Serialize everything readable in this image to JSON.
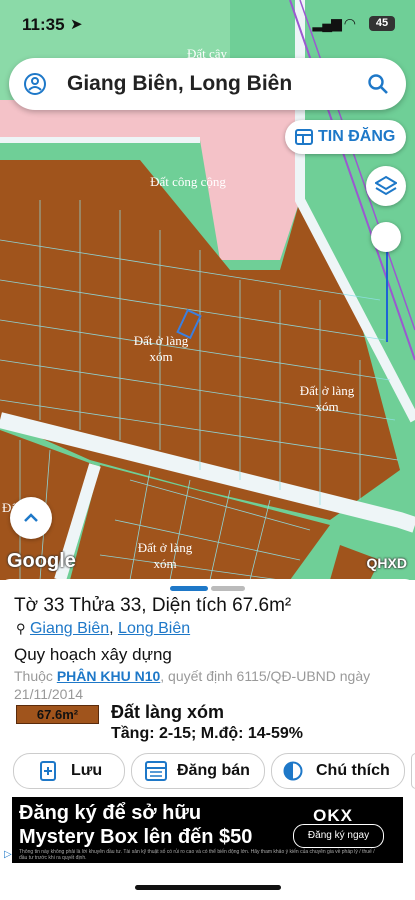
{
  "status_bar": {
    "time": "11:35",
    "battery": "45"
  },
  "search": {
    "query": "Giang Biên, Long Biên"
  },
  "map": {
    "tin_dang_label": "TIN ĐĂNG",
    "zone_labels": [
      "Đất cây",
      "Đất công cộng",
      "Đất ở làng xóm",
      "Đất ở làng xóm",
      "Đất ở làng xóm",
      "Đất",
      "Đất ở làng xóm"
    ],
    "google_label": "Google",
    "qhxd_label": "QHXD"
  },
  "parcel": {
    "title": "Tờ 33 Thửa 33, Diện tích 67.6m²",
    "ward": "Giang Biên",
    "district": "Long Biên",
    "planning_heading": "Quy hoạch xây dựng",
    "belongs_prefix": "Thuộc",
    "zone_link": "PHÂN KHU N10",
    "decision_text": ", quyết định 6115/QĐ-UBND ngày 21/11/2014",
    "area_badge": "67.6m²",
    "land_type": "Đất làng xóm",
    "floors_density": "Tầng: 2-15; M.độ: 14-59%"
  },
  "actions": {
    "save": "Lưu",
    "post": "Đăng bán",
    "legend": "Chú thích"
  },
  "ad": {
    "line1": "Đăng ký để sở hữu",
    "line2": "Mystery Box lên đến $50",
    "brand": "OKX",
    "cta": "Đăng ký ngay",
    "fine_print": "Thông tin này không phải là lời khuyên đầu tư. Tài sản kỹ thuật số có rủi ro cao và có thể biến động lớn. Hãy tham khảo ý kiến của chuyên gia về pháp lý / thuế / đầu tư trước khi ra quyết định."
  },
  "colors": {
    "accent": "#1e78c8",
    "residential": "#a0541c",
    "public": "#f4c2c8",
    "green": "#6fcf97"
  }
}
